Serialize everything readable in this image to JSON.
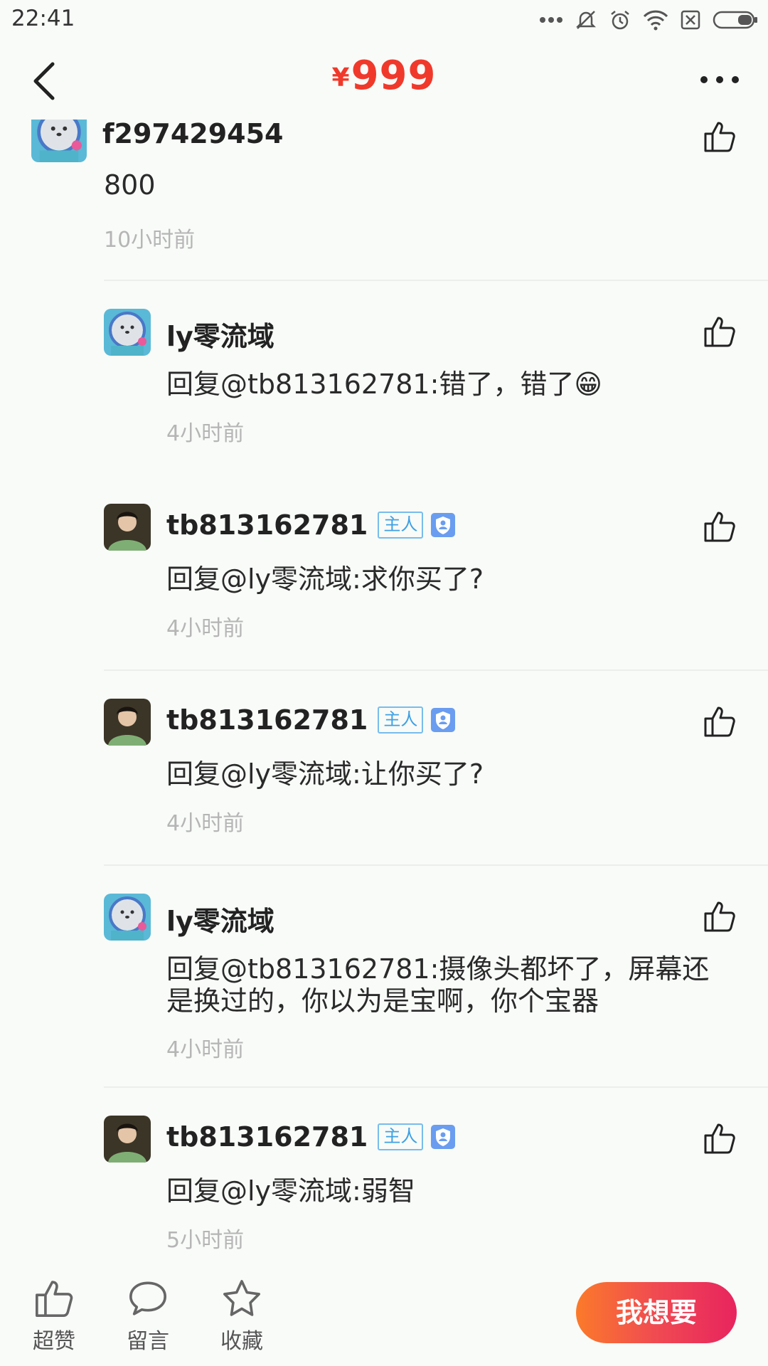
{
  "status_bar": {
    "time": "22:41"
  },
  "header": {
    "currency": "¥",
    "price": "999"
  },
  "first_comment": {
    "user": "f297429454",
    "text": "800",
    "time": "10小时前"
  },
  "replies": [
    {
      "user": "ly零流域",
      "is_owner": false,
      "text": "回复@tb813162781:错了，错了😁",
      "time": "4小时前"
    },
    {
      "user": "tb813162781",
      "is_owner": true,
      "badge": "主人",
      "text": "回复@ly零流域:求你买了?",
      "time": "4小时前"
    },
    {
      "user": "tb813162781",
      "is_owner": true,
      "badge": "主人",
      "text": "回复@ly零流域:让你买了?",
      "time": "4小时前"
    },
    {
      "user": "ly零流域",
      "is_owner": false,
      "text": "回复@tb813162781:摄像头都坏了，屏幕还是换过的，你以为是宝啊，你个宝器",
      "time": "4小时前"
    },
    {
      "user": "tb813162781",
      "is_owner": true,
      "badge": "主人",
      "text": "回复@ly零流域:弱智",
      "time": "5小时前"
    }
  ],
  "bottom_bar": {
    "like_label": "超赞",
    "comment_label": "留言",
    "favorite_label": "收藏",
    "want_label": "我想要"
  },
  "colors": {
    "price": "#f0392b",
    "owner_badge": "#3ea0e4",
    "want_gradient_start": "#fb7a2a",
    "want_gradient_end": "#e8245e"
  }
}
